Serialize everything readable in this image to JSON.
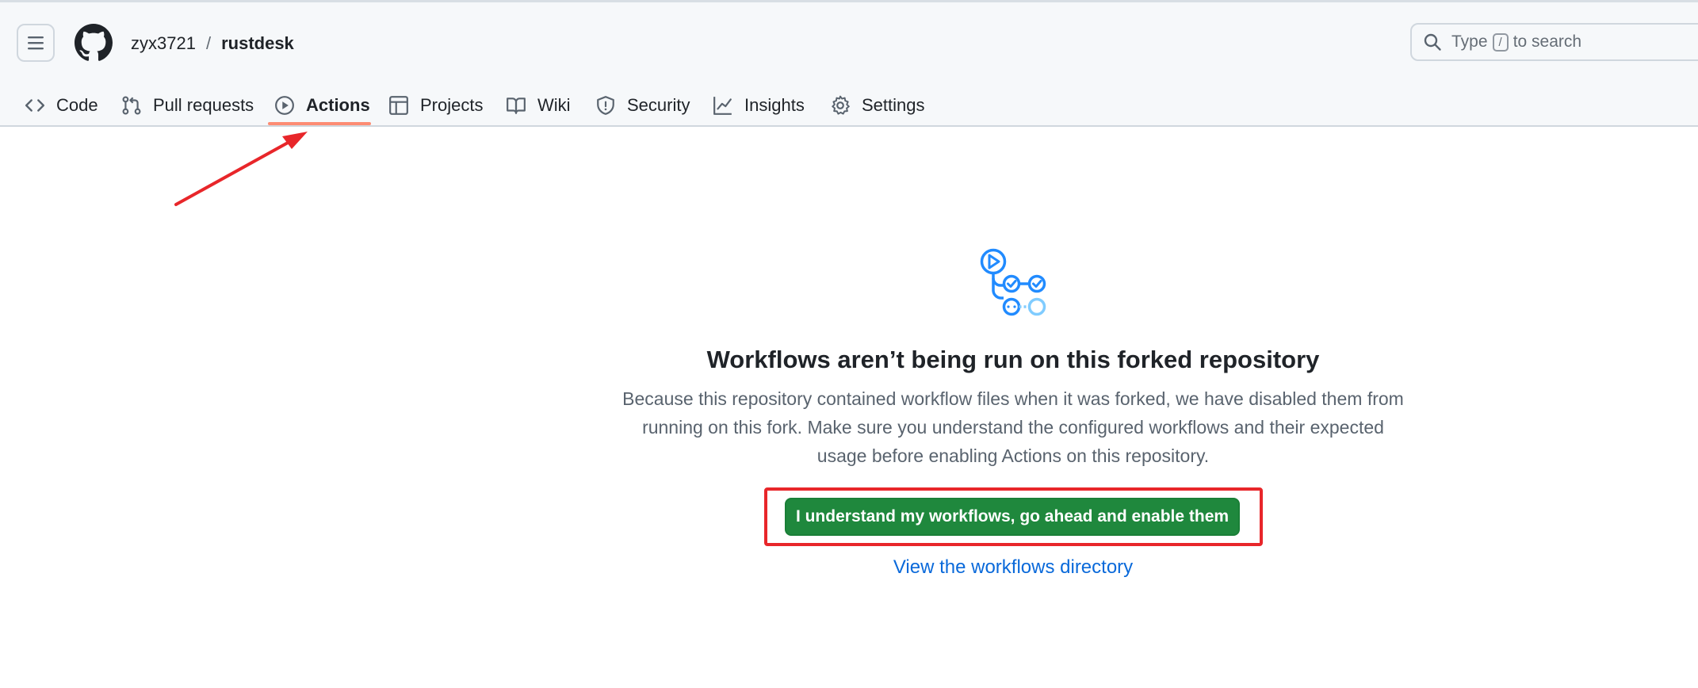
{
  "header": {
    "owner": "zyx3721",
    "separator": "/",
    "repo": "rustdesk",
    "search_prefix": "Type",
    "search_key": "/",
    "search_suffix": "to search"
  },
  "nav": {
    "tabs": [
      {
        "label": "Code",
        "icon": "code-icon"
      },
      {
        "label": "Pull requests",
        "icon": "pull-request-icon"
      },
      {
        "label": "Actions",
        "icon": "play-icon",
        "active": true
      },
      {
        "label": "Projects",
        "icon": "table-icon"
      },
      {
        "label": "Wiki",
        "icon": "book-icon"
      },
      {
        "label": "Security",
        "icon": "shield-icon"
      },
      {
        "label": "Insights",
        "icon": "graph-icon"
      },
      {
        "label": "Settings",
        "icon": "gear-icon"
      }
    ]
  },
  "main": {
    "title": "Workflows aren’t being run on this forked repository",
    "description_lines": [
      "Because this repository contained workflow files when it was forked, we have disabled them from",
      "running on this fork. Make sure you understand the configured workflows and their expected",
      "usage before enabling Actions on this repository."
    ],
    "enable_button": "I understand my workflows, go ahead and enable them",
    "workflows_link": "View the workflows directory"
  },
  "colors": {
    "primary_button": "#1f883d",
    "link": "#0969da",
    "active_underline": "#fd8c73",
    "annotation_red": "#e8262a"
  }
}
